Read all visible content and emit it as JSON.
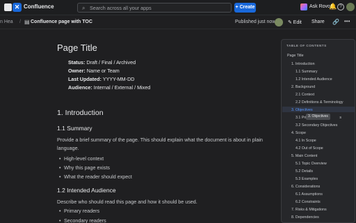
{
  "app": {
    "name": "Confluence",
    "search_placeholder": "Search across all your apps",
    "create_label": "+ Create",
    "rovo_label": "Ask Rovo",
    "search_icon": "⌕",
    "bell_icon": "🔔",
    "help_icon": "?"
  },
  "breadcrumb": {
    "space": "n Hea",
    "separator": "/",
    "page": "Confluence page with TOC",
    "page_icon": "▤"
  },
  "pagebar": {
    "status": "Published just now",
    "edit_label": "✎ Edit",
    "share_label": "Share",
    "link_icon": "🔗",
    "more_icon": "•••"
  },
  "doc": {
    "title": "Page Title",
    "meta": [
      {
        "label": "Status:",
        "value": " Draft / Final / Archived"
      },
      {
        "label": "Owner:",
        "value": " Name or Team"
      },
      {
        "label": "Last Updated:",
        "value": " YYYY-MM-DD"
      },
      {
        "label": "Audience:",
        "value": " Internal / External / Mixed"
      }
    ],
    "h_intro": "1. Introduction",
    "h_summary": "1.1 Summary",
    "summary_para": "Provide a brief summary of the page. This should explain what the document is about in plain language.",
    "summary_bullets": [
      "High-level context",
      "Why this page exists",
      "What the reader should expect"
    ],
    "h_audience": "1.2 Intended Audience",
    "audience_para": "Describe who should read this page and how it should be used.",
    "audience_bullets": [
      "Primary readers",
      "Secondary readers"
    ]
  },
  "toc": {
    "heading": "TABLE OF CONTENTS",
    "items": [
      "Page Title",
      "1. Introduction",
      "1.1 Summary",
      "1.2 Intended Audience",
      "2. Background",
      "2.1 Context",
      "2.2 Definitions & Terminology",
      "3. Objectives",
      "3.1 Pri",
      "3.2 Secondary Objectives",
      "4. Scope",
      "4.1 In Scope",
      "4.2 Out of Scope",
      "5. Main Content",
      "5.1 Topic Overview",
      "5.2 Details",
      "5.3 Examples",
      "6. Considerations",
      "6.1 Assumptions",
      "6.2 Constraints",
      "7. Risks & Mitigations",
      "8. Dependencies"
    ],
    "tooltip": "3. Objectives",
    "tooltip_tail": "s"
  }
}
